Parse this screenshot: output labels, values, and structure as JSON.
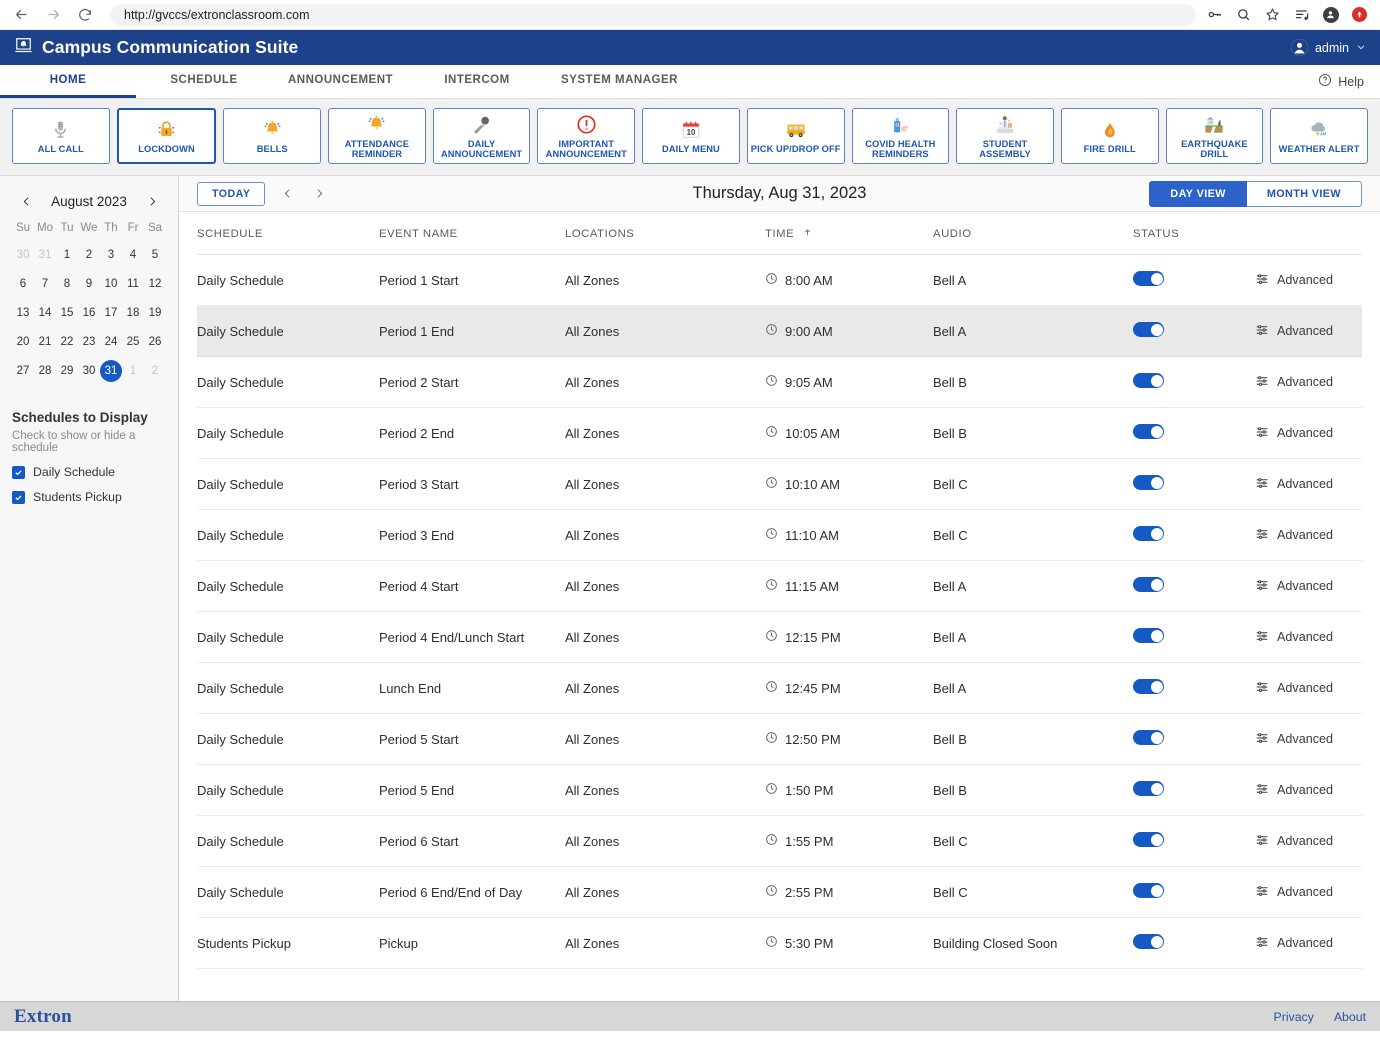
{
  "browser": {
    "url": "http://gvccs/extronclassroom.com",
    "back_icon": "back-arrow-icon",
    "forward_icon": "forward-arrow-icon",
    "reload_icon": "reload-icon",
    "toolbar_icons": [
      "key-icon",
      "search-icon",
      "star-icon",
      "reading-list-icon",
      "profile-icon",
      "update-icon"
    ]
  },
  "header": {
    "title": "Campus Communication Suite",
    "logo_icon": "bell-screen-logo-icon",
    "user": "admin",
    "user_chevron": "chevron-down-icon",
    "brand_color": "#1d4289"
  },
  "nav": {
    "tabs": [
      {
        "label": "HOME",
        "active": true
      },
      {
        "label": "SCHEDULE",
        "active": false
      },
      {
        "label": "ANNOUNCEMENT",
        "active": false
      },
      {
        "label": "INTERCOM",
        "active": false
      },
      {
        "label": "SYSTEM MANAGER",
        "active": false
      }
    ],
    "help_label": "Help",
    "help_icon": "question-circle-icon"
  },
  "tiles": [
    {
      "label": "ALL CALL",
      "icon": "microphone-icon",
      "selected": false
    },
    {
      "label": "LOCKDOWN",
      "icon": "padlock-icon",
      "selected": true
    },
    {
      "label": "BELLS",
      "icon": "bell-icon",
      "selected": false
    },
    {
      "label": "ATTENDANCE REMINDER",
      "icon": "bell-icon",
      "selected": false
    },
    {
      "label": "DAILY ANNOUNCEMENT",
      "icon": "microphone-icon",
      "selected": false
    },
    {
      "label": "IMPORTANT ANNOUNCEMENT",
      "icon": "exclamation-circle-icon",
      "selected": false
    },
    {
      "label": "DAILY MENU",
      "icon": "calendar-icon",
      "selected": false,
      "calendar_day": "10"
    },
    {
      "label": "PICK UP/DROP OFF",
      "icon": "school-bus-icon",
      "selected": false
    },
    {
      "label": "COVID HEALTH REMINDERS",
      "icon": "sanitizer-icon",
      "selected": false
    },
    {
      "label": "STUDENT ASSEMBLY",
      "icon": "assembly-icon",
      "selected": false
    },
    {
      "label": "FIRE DRILL",
      "icon": "flame-icon",
      "selected": false
    },
    {
      "label": "EARTHQUAKE DRILL",
      "icon": "earthquake-icon",
      "selected": false
    },
    {
      "label": "WEATHER ALERT",
      "icon": "storm-cloud-icon",
      "selected": false
    }
  ],
  "sidebar": {
    "calendar": {
      "month_label": "August 2023",
      "prev_icon": "chevron-left-icon",
      "next_icon": "chevron-right-icon",
      "weekday_headers": [
        "Su",
        "Mo",
        "Tu",
        "We",
        "Th",
        "Fr",
        "Sa"
      ],
      "selected_day": 31,
      "weeks": [
        [
          {
            "d": "30",
            "muted": true
          },
          {
            "d": "31",
            "muted": true
          },
          {
            "d": "1"
          },
          {
            "d": "2"
          },
          {
            "d": "3"
          },
          {
            "d": "4"
          },
          {
            "d": "5"
          }
        ],
        [
          {
            "d": "6"
          },
          {
            "d": "7"
          },
          {
            "d": "8"
          },
          {
            "d": "9"
          },
          {
            "d": "10"
          },
          {
            "d": "11"
          },
          {
            "d": "12"
          }
        ],
        [
          {
            "d": "13"
          },
          {
            "d": "14"
          },
          {
            "d": "15"
          },
          {
            "d": "16"
          },
          {
            "d": "17"
          },
          {
            "d": "18"
          },
          {
            "d": "19"
          }
        ],
        [
          {
            "d": "20"
          },
          {
            "d": "21"
          },
          {
            "d": "22"
          },
          {
            "d": "23"
          },
          {
            "d": "24"
          },
          {
            "d": "25"
          },
          {
            "d": "26"
          }
        ],
        [
          {
            "d": "27"
          },
          {
            "d": "28"
          },
          {
            "d": "29"
          },
          {
            "d": "30"
          },
          {
            "d": "31",
            "sel": true
          },
          {
            "d": "1",
            "muted": true
          },
          {
            "d": "2",
            "muted": true
          }
        ]
      ]
    },
    "schedules_title": "Schedules to Display",
    "schedules_subtitle": "Check to show or hide a schedule",
    "schedule_options": [
      {
        "label": "Daily Schedule",
        "checked": true
      },
      {
        "label": "Students Pickup",
        "checked": true
      }
    ]
  },
  "toolbar": {
    "today_label": "TODAY",
    "prev_icon": "chevron-left-icon",
    "next_icon": "chevron-right-icon",
    "date_title": "Thursday, Aug 31, 2023",
    "day_view_label": "DAY VIEW",
    "month_view_label": "MONTH VIEW",
    "active_view": "DAY VIEW"
  },
  "table": {
    "columns": [
      "SCHEDULE",
      "EVENT NAME",
      "LOCATIONS",
      "TIME",
      "AUDIO",
      "STATUS",
      ""
    ],
    "sort_column": "TIME",
    "sort_direction": "asc",
    "sort_icon": "arrow-up-icon",
    "clock_icon": "clock-icon",
    "advanced_label": "Advanced",
    "advanced_icon": "sliders-icon",
    "rows": [
      {
        "schedule": "Daily Schedule",
        "event": "Period 1 Start",
        "location": "All Zones",
        "time": "8:00 AM",
        "audio": "Bell A",
        "enabled": true,
        "highlighted": false
      },
      {
        "schedule": "Daily Schedule",
        "event": "Period 1 End",
        "location": "All Zones",
        "time": "9:00 AM",
        "audio": "Bell A",
        "enabled": true,
        "highlighted": true
      },
      {
        "schedule": "Daily Schedule",
        "event": "Period 2 Start",
        "location": "All Zones",
        "time": "9:05 AM",
        "audio": "Bell B",
        "enabled": true,
        "highlighted": false
      },
      {
        "schedule": "Daily Schedule",
        "event": "Period 2 End",
        "location": "All Zones",
        "time": "10:05 AM",
        "audio": "Bell B",
        "enabled": true,
        "highlighted": false
      },
      {
        "schedule": "Daily Schedule",
        "event": "Period 3 Start",
        "location": "All Zones",
        "time": "10:10 AM",
        "audio": "Bell C",
        "enabled": true,
        "highlighted": false
      },
      {
        "schedule": "Daily Schedule",
        "event": "Period 3 End",
        "location": "All Zones",
        "time": "11:10 AM",
        "audio": "Bell C",
        "enabled": true,
        "highlighted": false
      },
      {
        "schedule": "Daily Schedule",
        "event": "Period 4 Start",
        "location": "All Zones",
        "time": "11:15 AM",
        "audio": "Bell A",
        "enabled": true,
        "highlighted": false
      },
      {
        "schedule": "Daily Schedule",
        "event": "Period 4 End/Lunch Start",
        "location": "All Zones",
        "time": "12:15 PM",
        "audio": "Bell A",
        "enabled": true,
        "highlighted": false
      },
      {
        "schedule": "Daily Schedule",
        "event": "Lunch End",
        "location": "All Zones",
        "time": "12:45 PM",
        "audio": "Bell A",
        "enabled": true,
        "highlighted": false
      },
      {
        "schedule": "Daily Schedule",
        "event": "Period 5 Start",
        "location": "All Zones",
        "time": "12:50 PM",
        "audio": "Bell B",
        "enabled": true,
        "highlighted": false
      },
      {
        "schedule": "Daily Schedule",
        "event": "Period 5 End",
        "location": "All Zones",
        "time": "1:50 PM",
        "audio": "Bell B",
        "enabled": true,
        "highlighted": false
      },
      {
        "schedule": "Daily Schedule",
        "event": "Period 6 Start",
        "location": "All Zones",
        "time": "1:55 PM",
        "audio": "Bell C",
        "enabled": true,
        "highlighted": false
      },
      {
        "schedule": "Daily Schedule",
        "event": "Period 6 End/End of Day",
        "location": "All Zones",
        "time": "2:55 PM",
        "audio": "Bell C",
        "enabled": true,
        "highlighted": false
      },
      {
        "schedule": "Students Pickup",
        "event": "Pickup",
        "location": "All Zones",
        "time": "5:30 PM",
        "audio": "Building Closed Soon",
        "enabled": true,
        "highlighted": false
      }
    ]
  },
  "footer": {
    "logo": "Extron",
    "links": [
      "Privacy",
      "About"
    ]
  }
}
